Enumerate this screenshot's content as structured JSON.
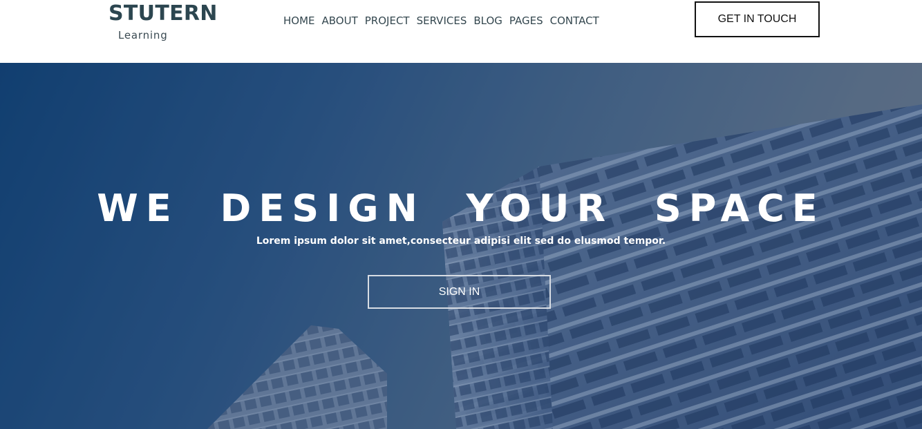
{
  "brand": {
    "name": "STUTERN",
    "tagline": "Learning"
  },
  "nav": {
    "items": [
      {
        "label": "HOME"
      },
      {
        "label": "ABOUT"
      },
      {
        "label": "PROJECT"
      },
      {
        "label": "SERVICES"
      },
      {
        "label": "BLOG"
      },
      {
        "label": "PAGES"
      },
      {
        "label": "CONTACT"
      }
    ]
  },
  "header": {
    "cta_label": "GET IN TOUCH"
  },
  "hero": {
    "title": "WE DESIGN YOUR SPACE",
    "subtitle": "Lorem ipsum dolor sit amet,consecteur adipisi elit sed do elusmod tempor.",
    "signin_label": "SIGN IN",
    "background_image": "skyscraper-photo"
  },
  "colors": {
    "brand_text": "#2c4650",
    "nav_text": "#34474f",
    "hero_overlay": "#1e4a7c",
    "white": "#ffffff"
  }
}
